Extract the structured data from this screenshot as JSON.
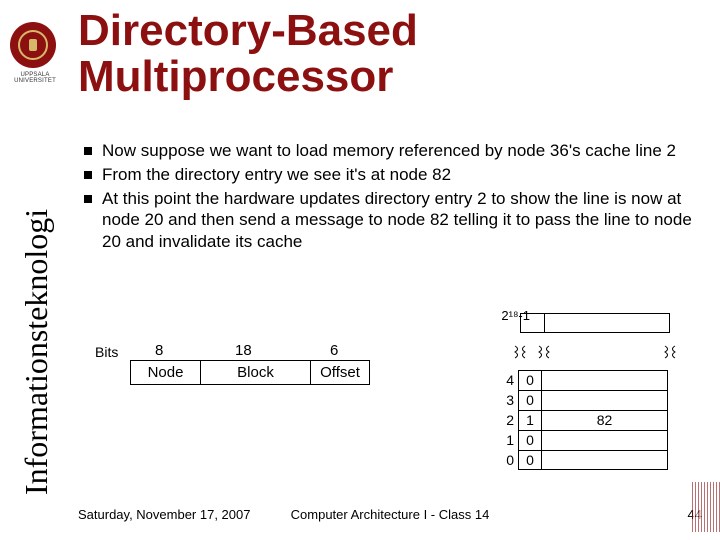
{
  "brand": {
    "university": "UPPSALA UNIVERSITET",
    "sidebar_text": "Informationsteknologi"
  },
  "title": "Directory-Based Multiprocessor",
  "bullets": [
    "Now suppose we want to load memory referenced by node 36's cache line 2",
    "From the directory entry we see it's at node 82",
    "At this point the hardware updates directory entry 2 to show the line is now at node 20 and then send a message to node 82 telling it to pass the line to node 20 and invalidate its cache"
  ],
  "diagram": {
    "bits_label": "Bits",
    "field_widths": [
      "8",
      "18",
      "6"
    ],
    "field_names": [
      "Node",
      "Block",
      "Offset"
    ],
    "dir_top_label": "2¹⁸-1",
    "rows": [
      {
        "idx": "4",
        "state": "0",
        "node": ""
      },
      {
        "idx": "3",
        "state": "0",
        "node": ""
      },
      {
        "idx": "2",
        "state": "1",
        "node": "82"
      },
      {
        "idx": "1",
        "state": "0",
        "node": ""
      },
      {
        "idx": "0",
        "state": "0",
        "node": ""
      }
    ]
  },
  "footer": {
    "date": "Saturday, November 17, 2007",
    "course": "Computer Architecture I - Class 14",
    "page": "44"
  },
  "colors": {
    "brand": "#8c1010"
  }
}
